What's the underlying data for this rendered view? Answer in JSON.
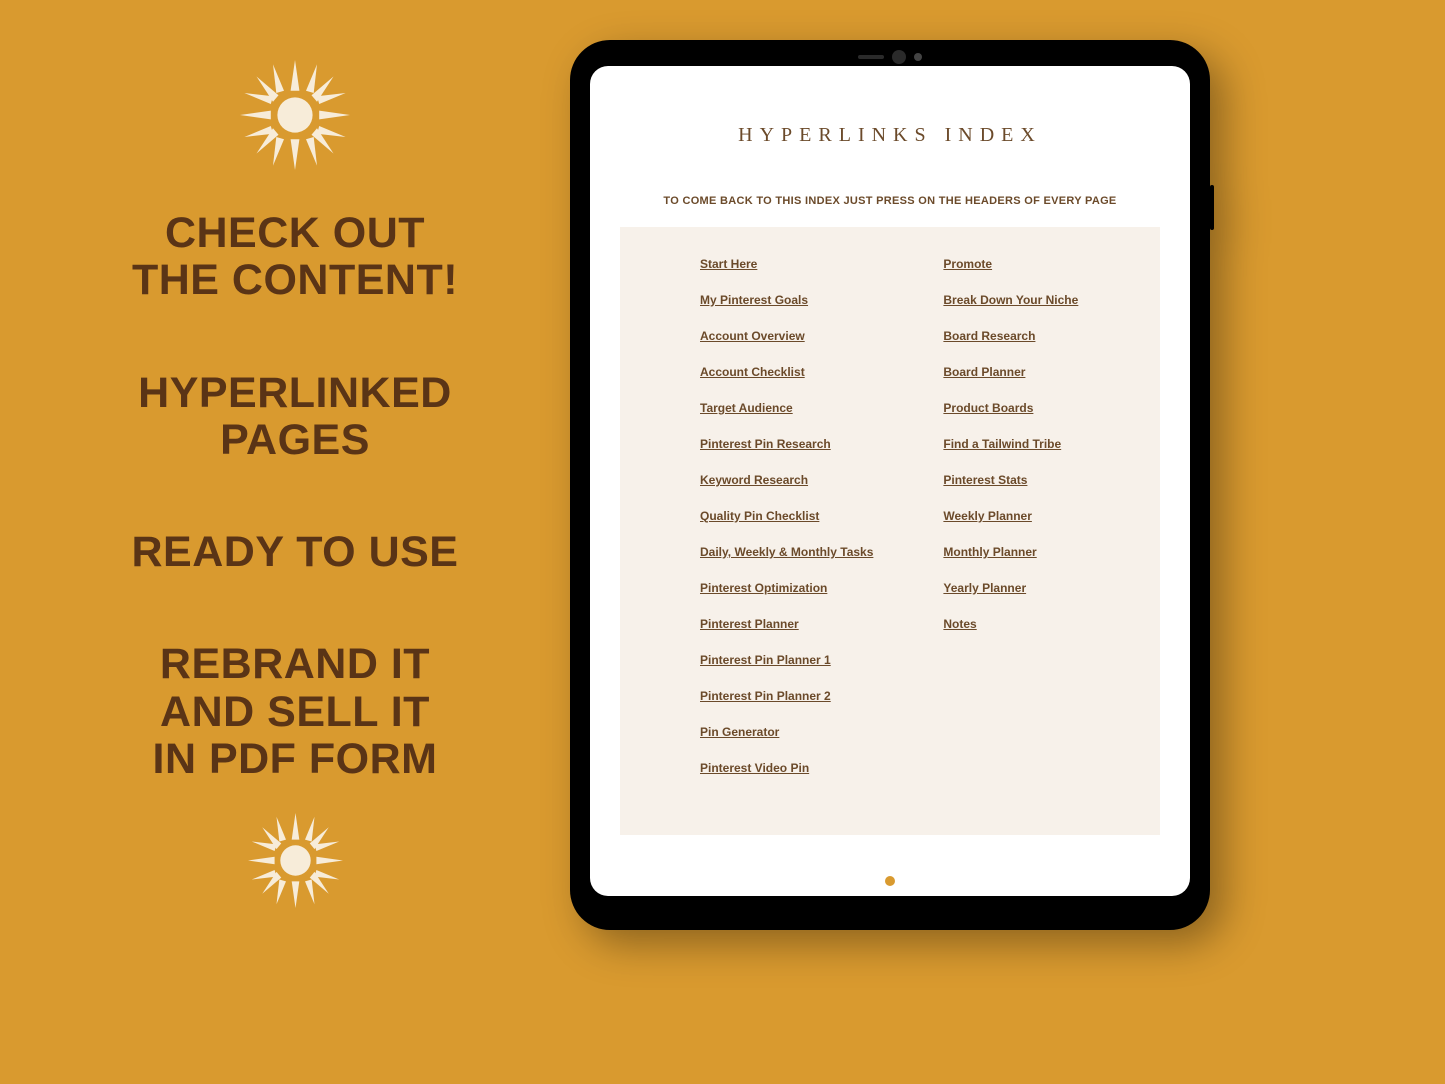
{
  "promo": {
    "line1": "CHECK OUT",
    "line2": "THE CONTENT!",
    "line3": "HYPERLINKED",
    "line4": "PAGES",
    "line5": "READY TO USE",
    "line6": "REBRAND IT",
    "line7": "AND SELL IT",
    "line8": "IN PDF FORM"
  },
  "tablet": {
    "title": "HYPERLINKS INDEX",
    "subtitle": "TO COME BACK TO THIS INDEX JUST PRESS ON THE HEADERS OF EVERY PAGE",
    "col1": [
      "Start Here",
      "My Pinterest Goals",
      "Account Overview",
      "Account Checklist",
      "Target Audience",
      "Pinterest Pin Research",
      "Keyword Research",
      "Quality Pin Checklist",
      "Daily, Weekly & Monthly Tasks",
      "Pinterest Optimization",
      "Pinterest Planner",
      "Pinterest Pin Planner 1",
      "Pinterest Pin Planner 2",
      "Pin Generator ",
      "Pinterest Video Pin"
    ],
    "col2": [
      "Promote",
      "Break Down Your Niche",
      "Board Research",
      "Board Planner",
      "Product Boards",
      "Find a Tailwind Tribe",
      "Pinterest Stats",
      "Weekly Planner",
      "Monthly Planner",
      "Yearly Planner",
      "Notes"
    ]
  }
}
